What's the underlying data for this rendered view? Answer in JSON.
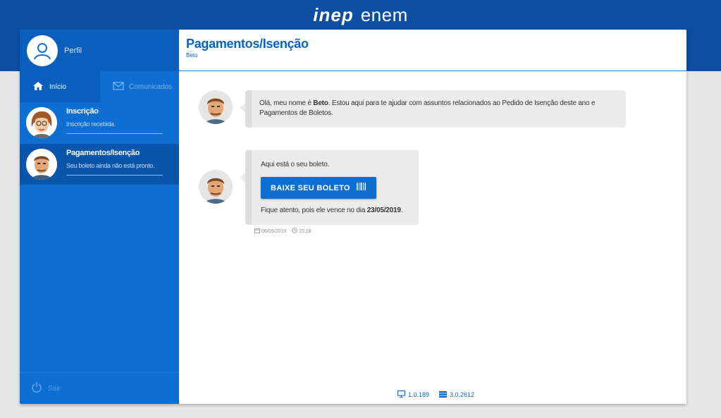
{
  "brand": {
    "inep": "inep",
    "enem": "enem"
  },
  "sidebar": {
    "profile_label": "Perfil",
    "tabs": [
      {
        "label": "Início",
        "icon": "home-icon",
        "active": true
      },
      {
        "label": "Comunicados",
        "icon": "envelope-icon",
        "active": false
      }
    ],
    "conversations": [
      {
        "title": "Inscrição",
        "subtitle": "Inscrição recebida."
      },
      {
        "title": "Pagamentos/Isenção",
        "subtitle": "Seu boleto ainda não está pronto."
      }
    ],
    "sair_label": "Sair"
  },
  "main": {
    "title": "Pagamentos/Isenção",
    "subtitle": "Beto",
    "messages": [
      {
        "text_before": "Olá, meu nome é ",
        "name": "Beto",
        "text_after": ". Estou aqui para te ajudar com assuntos relacionados ao Pedido de Isenção deste ano e Pagamentos de Boletos."
      },
      {
        "intro": "Aqui está o seu boleto.",
        "button_label": "BAIXE SEU BOLETO",
        "due_before": "Fique atento, pois ele vence no dia ",
        "due_date": "23/05/2019",
        "due_after": ".",
        "date": "06/05/2019",
        "time": "15:18"
      }
    ]
  },
  "footer": {
    "version_front": "1.0.189",
    "version_back": "3.0.2612"
  },
  "colors": {
    "brand_blue": "#0b4ea2",
    "sidebar_blue": "#0c6fd1",
    "accent": "#0b63c1"
  }
}
